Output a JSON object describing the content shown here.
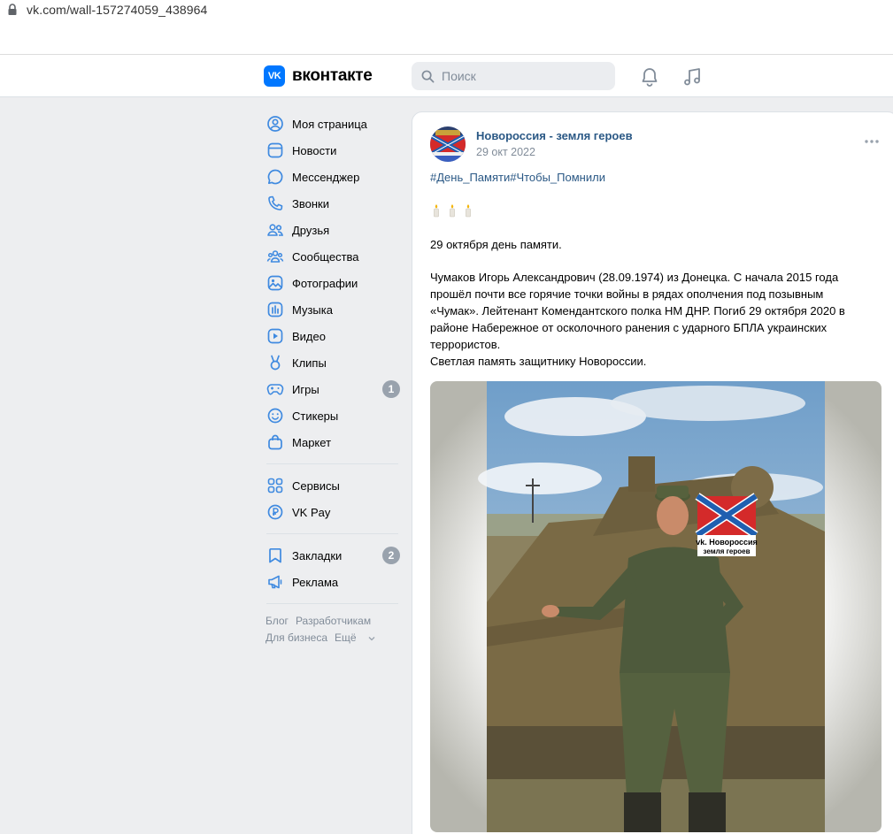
{
  "browser": {
    "url": "vk.com/wall-157274059_438964"
  },
  "header": {
    "logo_mark": "VK",
    "logo_text": "вконтакте",
    "search_placeholder": "Поиск"
  },
  "sidebar": {
    "items": [
      {
        "label": "Моя страница",
        "icon": "user-circle-icon"
      },
      {
        "label": "Новости",
        "icon": "news-icon"
      },
      {
        "label": "Мессенджер",
        "icon": "message-icon"
      },
      {
        "label": "Звонки",
        "icon": "phone-icon"
      },
      {
        "label": "Друзья",
        "icon": "friends-icon"
      },
      {
        "label": "Сообщества",
        "icon": "communities-icon"
      },
      {
        "label": "Фотографии",
        "icon": "photo-icon"
      },
      {
        "label": "Музыка",
        "icon": "music-icon"
      },
      {
        "label": "Видео",
        "icon": "video-icon"
      },
      {
        "label": "Клипы",
        "icon": "clips-icon"
      },
      {
        "label": "Игры",
        "icon": "gamepad-icon",
        "badge": "1"
      },
      {
        "label": "Стикеры",
        "icon": "sticker-icon"
      },
      {
        "label": "Маркет",
        "icon": "market-bag-icon"
      }
    ],
    "items2": [
      {
        "label": "Сервисы",
        "icon": "services-icon"
      },
      {
        "label": "VK Pay",
        "icon": "vkpay-icon"
      }
    ],
    "items3": [
      {
        "label": "Закладки",
        "icon": "bookmark-icon",
        "badge": "2"
      },
      {
        "label": "Реклама",
        "icon": "megaphone-icon"
      }
    ],
    "footer": {
      "blog": "Блог",
      "developers": "Разработчикам",
      "business": "Для бизнеса",
      "more": "Ещё"
    }
  },
  "post": {
    "author": "Новороссия - земля героев",
    "date": "29 окт 2022",
    "hashtags": "#День_Памяти#Чтобы_Помнили",
    "p1": "29 октября день памяти.",
    "p2_lines": [
      "Чумаков Игорь Александрович (28.09.1974) из Донецка. С начала 2015 года",
      "прошёл почти все горячие точки войны в рядах ополчения под позывным",
      "«Чумак». Лейтенант Комендантского полка НМ ДНР. Погиб 29 октября 2020 в",
      "районе Набережное от осколочного ранения с ударного БПЛА украинских",
      "террористов.",
      "Светлая память защитнику Новороссии."
    ],
    "watermark_line1": "vk. Новороссия",
    "watermark_line2": "земля героев"
  },
  "colors": {
    "accent": "#0077ff",
    "link": "#2a5885",
    "muted": "#818c99",
    "badge": "#99a2ad",
    "icon": "#3f8ae0"
  }
}
